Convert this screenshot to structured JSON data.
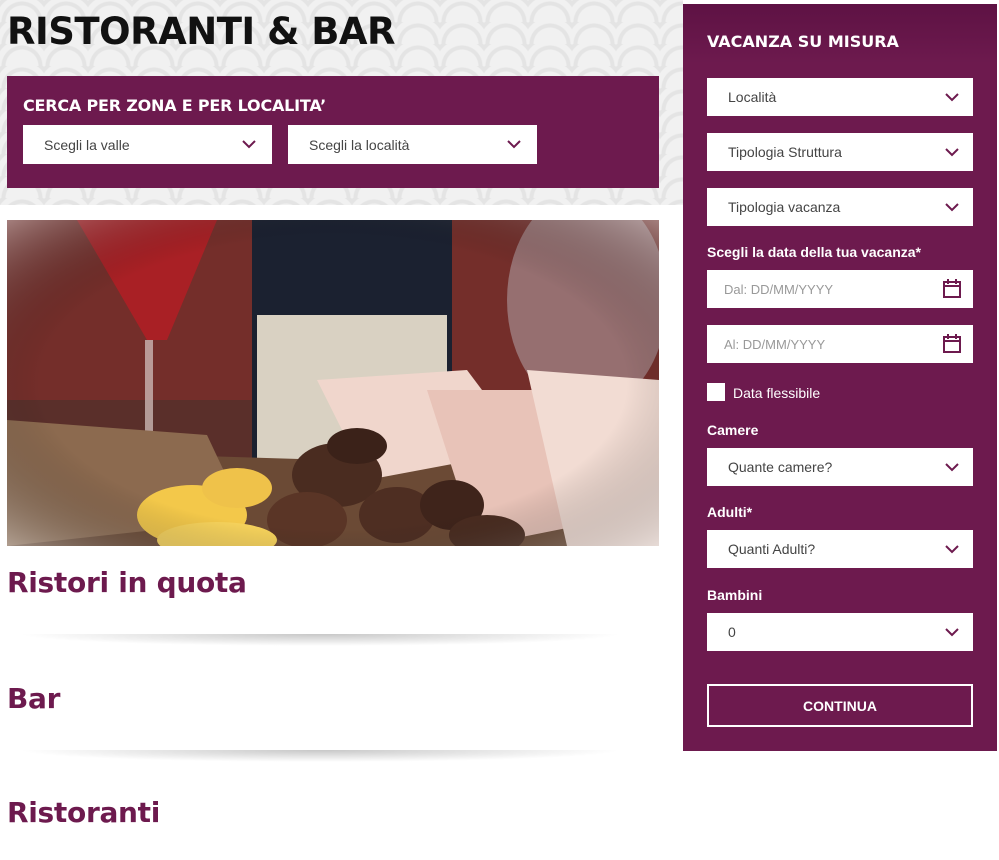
{
  "page": {
    "title": "RISTORANTI & BAR"
  },
  "search": {
    "title": "CERCA PER ZONA E PER LOCALITA’",
    "valley_select": "Scegli la valle",
    "locality_select": "Scegli la località"
  },
  "sections": [
    {
      "heading": "Ristori in quota"
    },
    {
      "heading": "Bar"
    },
    {
      "heading": "Ristoranti"
    }
  ],
  "sidebar": {
    "title": "VACANZA SU MISURA",
    "locality": "Località",
    "structure_type": "Tipologia Struttura",
    "vacation_type": "Tipologia vacanza",
    "date_label": "Scegli la data della tua vacanza*",
    "date_from_placeholder": "Dal: DD/MM/YYYY",
    "date_to_placeholder": "Al: DD/MM/YYYY",
    "flexible_date": "Data flessibile",
    "rooms_label": "Camere",
    "rooms_select": "Quante camere?",
    "adults_label": "Adulti*",
    "adults_select": "Quanti Adulti?",
    "children_label": "Bambini",
    "children_select": "0",
    "continue_button": "CONTINUA"
  },
  "colors": {
    "brand": "#6d1a4e",
    "title_text": "#111111",
    "white": "#ffffff"
  }
}
